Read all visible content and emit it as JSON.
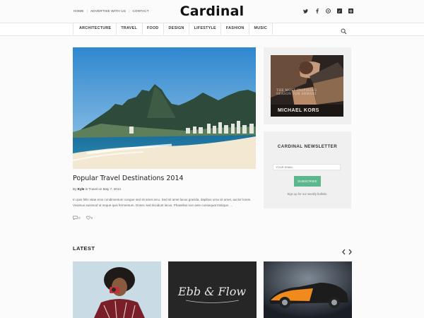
{
  "top_links": [
    "HOME",
    "ADVERTISE WITH US",
    "CONTACT"
  ],
  "site": {
    "logo": "Cardinal"
  },
  "social_icons": [
    "twitter-icon",
    "facebook-icon",
    "instagram-icon",
    "vimeo-icon",
    "instagram-square-icon"
  ],
  "nav": {
    "items": [
      "ARCHITECTURE",
      "TRAVEL",
      "FOOD",
      "DESIGN",
      "LIFESTYLE",
      "FASHION",
      "MUSIC"
    ]
  },
  "featured": {
    "title": "Popular Travel Destinations 2014",
    "meta": {
      "by": "By",
      "author": "Kyle",
      "in_text": "in Travel on May 7, 2014"
    },
    "excerpt": "In quis felis vitae eros condimentum congue sed sit amet arcu. Sed sit amet lacus gravida, dapibus urna sit amet, auctor lorem. Vivamus euismod ut neque quis fermentum. Donec sed tincidunt lacus. Phasellus non ante consequat tristique. ...",
    "comments": "0",
    "likes": "0"
  },
  "ad": {
    "tagline": "THE MOST INSPIRING SEASON FOR ARMANI",
    "brand": "MICHAEL KORS"
  },
  "newsletter": {
    "title": "CARDINAL NEWSLETTER",
    "placeholder": "YOUR EMAIL",
    "button": "SUBSCRIBE",
    "note": "Sign up for our weekly bulletin."
  },
  "latest": {
    "title": "LATEST"
  },
  "thumbnails": [
    {
      "image_text": ""
    },
    {
      "image_text": "Ebb & Flow"
    },
    {
      "image_text": ""
    }
  ],
  "colors": {
    "accent_green": "#5cb78e",
    "background": "#fbfbfb"
  }
}
